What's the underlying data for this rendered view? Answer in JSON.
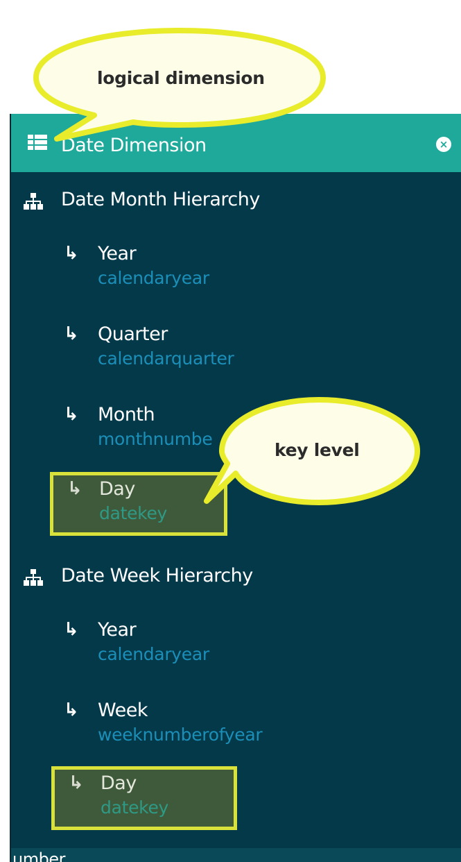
{
  "callouts": {
    "logical": "logical dimension",
    "key": "key level"
  },
  "panel": {
    "title": "Date Dimension",
    "title_icon": "table-icon",
    "close_icon": "close-icon",
    "close_glyph": "×"
  },
  "hierarchies": [
    {
      "name": "Date Month Hierarchy",
      "icon": "hierarchy-icon",
      "levels": [
        {
          "name": "Year",
          "column": "calendaryear"
        },
        {
          "name": "Quarter",
          "column": "calendarquarter"
        },
        {
          "name": "Month",
          "column": "monthnumbe"
        },
        {
          "name": "Day",
          "column": "datekey",
          "key": true
        }
      ]
    },
    {
      "name": "Date Week Hierarchy",
      "icon": "hierarchy-icon",
      "levels": [
        {
          "name": "Year",
          "column": "calendaryear"
        },
        {
          "name": "Week",
          "column": "weeknumberofyear"
        },
        {
          "name": "Day",
          "column": "datekey",
          "key": true
        }
      ]
    }
  ],
  "level_arrow": "↳",
  "bottom_fragment": "umber",
  "colors": {
    "panel_bg": "#04394a",
    "header_bg": "#1fa99a",
    "column_text": "#1b8fb8",
    "highlight_border": "#d9e23a",
    "callout_fill": "#fdfde8",
    "callout_border": "#e8ec2a"
  }
}
